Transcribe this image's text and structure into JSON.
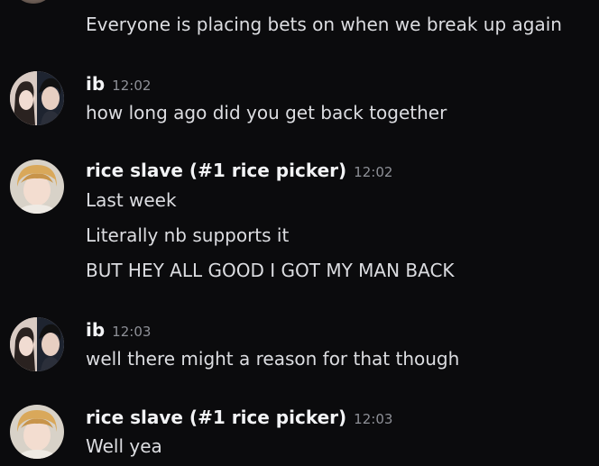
{
  "messages": [
    {
      "username": "ib",
      "time": "12:02",
      "avatar": "ib-avatar",
      "lines": [
        "how long ago did you get back together"
      ]
    },
    {
      "username": "rice slave (#1 rice picker)",
      "time": "12:02",
      "avatar": "rice-slave-avatar",
      "lines": [
        "Last week",
        "Literally nb supports it",
        "BUT HEY ALL GOOD I GOT MY MAN BACK"
      ]
    },
    {
      "username": "ib",
      "time": "12:03",
      "avatar": "ib-avatar",
      "lines": [
        "well there might a reason for that though"
      ]
    },
    {
      "username": "rice slave (#1 rice picker)",
      "time": "12:03",
      "avatar": "rice-slave-avatar",
      "lines": [
        "Well yea"
      ]
    }
  ],
  "continuation": "Everyone is placing bets on when we break up again",
  "colors": {
    "background": "#0b0b0d",
    "username": "#f2f3f5",
    "text": "#dcdde1",
    "timestamp": "#8e9097"
  }
}
